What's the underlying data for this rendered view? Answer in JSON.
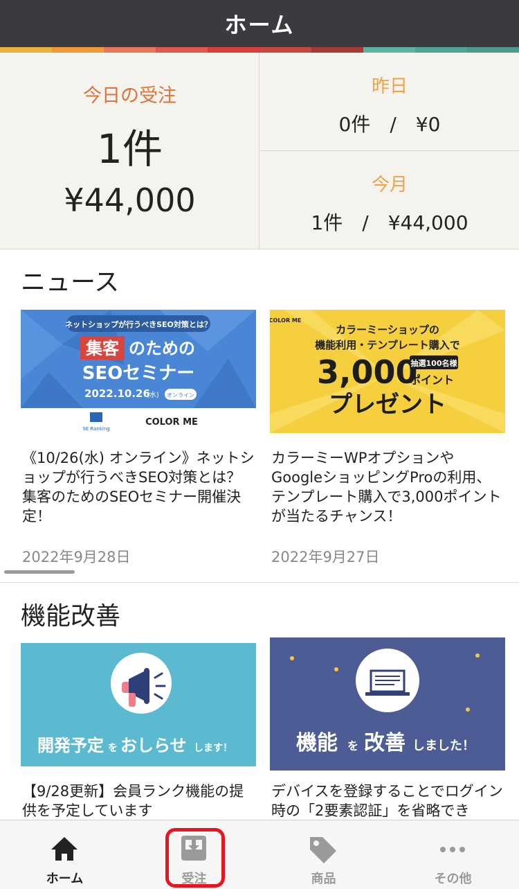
{
  "header": {
    "title": "ホーム"
  },
  "colors": {
    "stripe": [
      "#e8b23a",
      "#ef9a37",
      "#e8765d",
      "#e0584c",
      "#d63f3a",
      "#c84640",
      "#a33a36",
      "#5bb4a0",
      "#4fa592",
      "#4f9988"
    ]
  },
  "summary": {
    "today": {
      "label": "今日の受注",
      "count": "1件",
      "amount": "¥44,000"
    },
    "yesterday": {
      "label": "昨日",
      "value": "0件　/　¥0"
    },
    "month": {
      "label": "今月",
      "value": "1件　/　¥44,000"
    }
  },
  "news": {
    "title": "ニュース",
    "items": [
      {
        "banner": {
          "top": "ネットショップが行うべきSEO対策とは？",
          "highlight": "集客",
          "rest": "のための",
          "line2": "SEOセミナー",
          "date": "2022.10.26",
          "weekday": "(水)",
          "badge": "オンライン",
          "logo1": "SE Ranking",
          "logo2": "COLOR ME"
        },
        "text": "《10/26(水) オンライン》ネットショップが行うべきSEO対策とは？集客のためのSEOセミナー開催決定！",
        "date": "2022年9月28日"
      },
      {
        "banner": {
          "logo": "COLOR ME",
          "line1": "カラーミーショップの",
          "line2": "機能利用・テンプレート購入で",
          "big": "3,000",
          "tag": "抽選100名様",
          "unit": "ポイント",
          "present": "プレゼント"
        },
        "text": "カラーミーWPオプションやGoogleショッピングProの利用、テンプレート購入で3,000ポイントが当たるチャンス！",
        "date": "2022年9月27日"
      }
    ]
  },
  "improvements": {
    "title": "機能改善",
    "items": [
      {
        "banner": {
          "bold": "開発予定",
          "small1": "を",
          "bold2": "おしらせ",
          "small2": "します！"
        },
        "text": "【9/28更新】会員ランク機能の提供を予定しています"
      },
      {
        "banner": {
          "bold": "機能",
          "small1": "を",
          "bold2": "改善",
          "small2": "しました！"
        },
        "text": "デバイスを登録することでログイン時の「2要素認証」を省略でき"
      }
    ]
  },
  "tabs": [
    {
      "label": "ホーム",
      "icon": "home-icon",
      "color": "#222222"
    },
    {
      "label": "受注",
      "icon": "inbox-download-icon",
      "color": "#9a9a9a"
    },
    {
      "label": "商品",
      "icon": "tag-icon",
      "color": "#9a9a9a"
    },
    {
      "label": "その他",
      "icon": "more-dots-icon",
      "color": "#9a9a9a"
    }
  ]
}
